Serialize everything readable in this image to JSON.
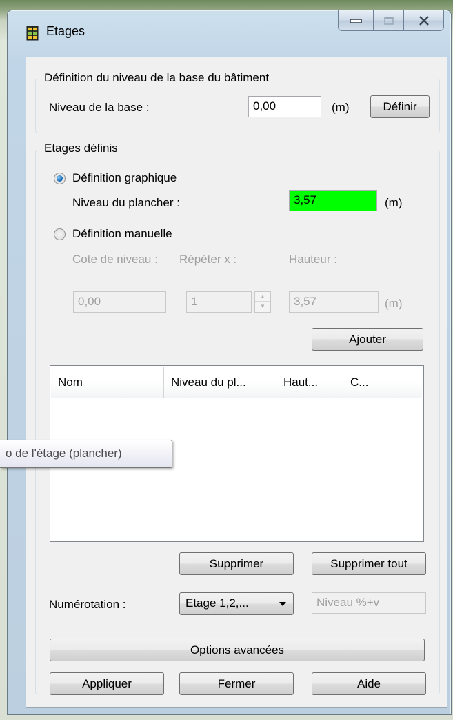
{
  "window": {
    "title": "Etages",
    "icon": "building-floors-icon"
  },
  "base_group": {
    "legend": "Définition du niveau de la base du bâtiment",
    "label": "Niveau de la base :",
    "value": "0,00",
    "unit": "(m)",
    "button": "Définir"
  },
  "floors_group": {
    "legend": "Etages définis",
    "graphic": {
      "label": "Définition graphique",
      "selected": true,
      "floor_level_label": "Niveau du plancher :",
      "floor_level_value": "3,57",
      "floor_level_color": "#00ff00",
      "unit": "(m)"
    },
    "manual": {
      "label": "Définition manuelle",
      "selected": false,
      "cote_label": "Cote de niveau :",
      "repeat_label": "Répéter x :",
      "height_label": "Hauteur :",
      "cote_value": "0,00",
      "repeat_value": "1",
      "height_value": "3,57",
      "unit": "(m)"
    },
    "add_button": "Ajouter",
    "list": {
      "columns": [
        "Nom",
        "Niveau du pl...",
        "Haut...",
        "C..."
      ],
      "rows": []
    },
    "delete_button": "Supprimer",
    "delete_all_button": "Supprimer tout",
    "numbering_label": "Numérotation :",
    "numbering_value": "Etage 1,2,...",
    "niveau_placeholder": "Niveau %+v"
  },
  "tooltip": "o de l'étage (plancher)",
  "buttons": {
    "advanced": "Options avancées",
    "apply": "Appliquer",
    "close": "Fermer",
    "help": "Aide"
  }
}
